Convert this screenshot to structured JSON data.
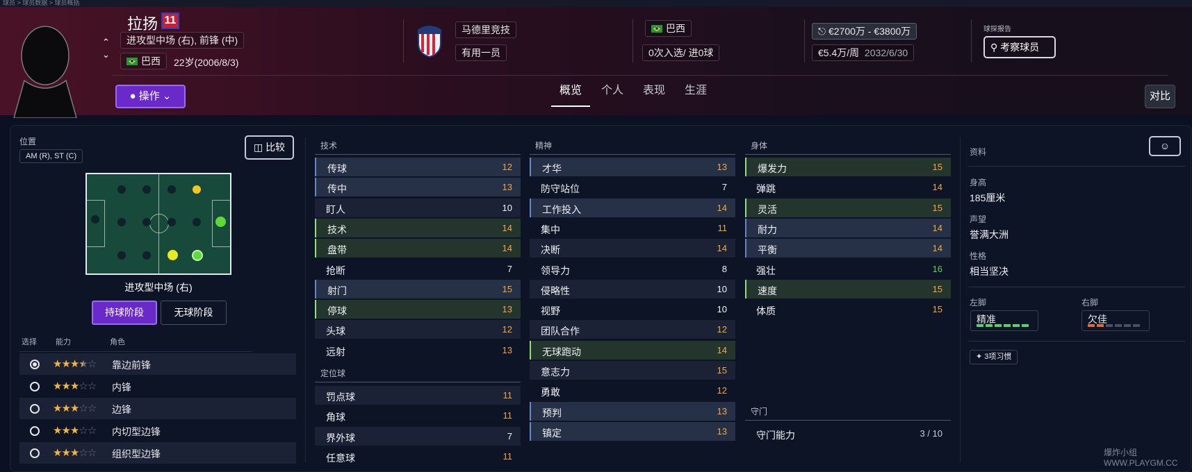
{
  "breadcrumb": "球员 > 球员数据 > 球员概括",
  "player": {
    "name": "拉扬",
    "number": "11",
    "positions": "进攻型中场 (右), 前锋 (中)",
    "nationality": "巴西",
    "age": "22岁(2006/8/3)",
    "club": "马德里竞技",
    "squad_status": "有用一员",
    "intl_nation": "巴西",
    "intl_caps": "0次入选/ 进0球",
    "value": "€2700万 - €3800万",
    "wage": "€5.4万/周",
    "contract": "2032/6/30",
    "scout_report_label": "球探报告",
    "scout_button": "考察球员"
  },
  "actions_button": "操作",
  "tabs": [
    {
      "label": "概览",
      "active": true
    },
    {
      "label": "个人"
    },
    {
      "label": "表现"
    },
    {
      "label": "生涯"
    }
  ],
  "compare_top": "对比",
  "position_panel": {
    "title": "位置",
    "short": "AM (R), ST (C)",
    "compare_button": "比较",
    "current_position": "进攻型中场 (右)",
    "phase_in": "持球阶段",
    "phase_out": "无球阶段",
    "headers": {
      "select": "选择",
      "ability": "能力",
      "role": "角色"
    },
    "roles": [
      {
        "name": "靠边前锋",
        "stars": 3.5,
        "selected": true
      },
      {
        "name": "内锋",
        "stars": 3
      },
      {
        "name": "边锋",
        "stars": 3
      },
      {
        "name": "内切型边锋",
        "stars": 3
      },
      {
        "name": "组织型边锋",
        "stars": 3
      }
    ]
  },
  "technical": {
    "title": "技术",
    "attrs": [
      {
        "name": "传球",
        "value": "12",
        "hl": "b"
      },
      {
        "name": "传中",
        "value": "13",
        "hl": "b"
      },
      {
        "name": "盯人",
        "value": "10"
      },
      {
        "name": "技术",
        "value": "14",
        "hl": "g"
      },
      {
        "name": "盘带",
        "value": "14",
        "hl": "g"
      },
      {
        "name": "抢断",
        "value": "7"
      },
      {
        "name": "射门",
        "value": "15",
        "hl": "b"
      },
      {
        "name": "停球",
        "value": "13",
        "hl": "g"
      },
      {
        "name": "头球",
        "value": "12"
      },
      {
        "name": "远射",
        "value": "13"
      }
    ]
  },
  "set_pieces": {
    "title": "定位球",
    "attrs": [
      {
        "name": "罚点球",
        "value": "11"
      },
      {
        "name": "角球",
        "value": "11"
      },
      {
        "name": "界外球",
        "value": "7"
      },
      {
        "name": "任意球",
        "value": "11"
      }
    ]
  },
  "mental": {
    "title": "精神",
    "attrs": [
      {
        "name": "才华",
        "value": "13",
        "hl": "b"
      },
      {
        "name": "防守站位",
        "value": "7"
      },
      {
        "name": "工作投入",
        "value": "14",
        "hl": "b"
      },
      {
        "name": "集中",
        "value": "11"
      },
      {
        "name": "决断",
        "value": "14"
      },
      {
        "name": "领导力",
        "value": "8"
      },
      {
        "name": "侵略性",
        "value": "10"
      },
      {
        "name": "视野",
        "value": "10"
      },
      {
        "name": "团队合作",
        "value": "12"
      },
      {
        "name": "无球跑动",
        "value": "14",
        "hl": "g"
      },
      {
        "name": "意志力",
        "value": "15"
      },
      {
        "name": "勇敢",
        "value": "12"
      },
      {
        "name": "预判",
        "value": "13",
        "hl": "b"
      },
      {
        "name": "镇定",
        "value": "13",
        "hl": "b"
      }
    ]
  },
  "physical": {
    "title": "身体",
    "attrs": [
      {
        "name": "爆发力",
        "value": "15",
        "hl": "g"
      },
      {
        "name": "弹跳",
        "value": "14"
      },
      {
        "name": "灵活",
        "value": "15",
        "hl": "g"
      },
      {
        "name": "耐力",
        "value": "14",
        "hl": "b"
      },
      {
        "name": "平衡",
        "value": "14",
        "hl": "b"
      },
      {
        "name": "强壮",
        "value": "16",
        "color": "gr"
      },
      {
        "name": "速度",
        "value": "15",
        "hl": "g"
      },
      {
        "name": "体质",
        "value": "15"
      }
    ]
  },
  "goalkeeping": {
    "title": "守门",
    "label": "守门能力",
    "value": "3 / 10"
  },
  "info": {
    "title": "资料",
    "height_label": "身高",
    "height": "185厘米",
    "rep_label": "声望",
    "rep": "誉满大洲",
    "pers_label": "性格",
    "pers": "相当坚决",
    "left_foot_label": "左脚",
    "left_foot": "精准",
    "right_foot_label": "右脚",
    "right_foot": "欠佳",
    "habits": "3项习惯"
  },
  "watermark": "爆炸小组 WWW.PLAYGM.CC",
  "colors": {
    "accent": "#6a29c9",
    "attr_orange": "#f1a740",
    "attr_green": "#55d36a"
  }
}
